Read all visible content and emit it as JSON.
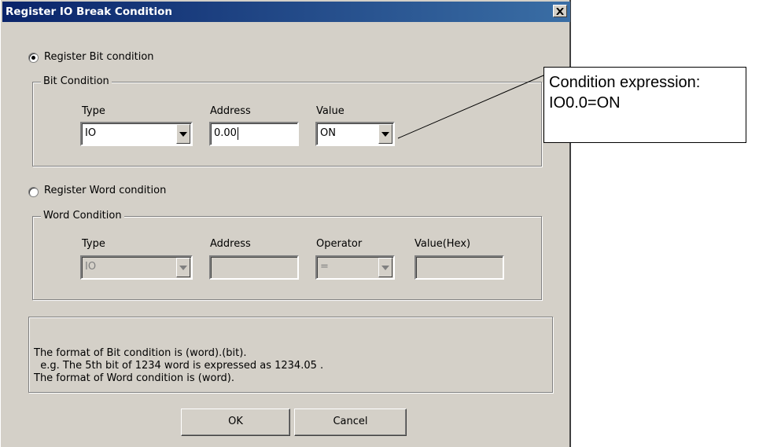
{
  "dialog": {
    "title": "Register IO Break Condition",
    "close_icon": "close-icon",
    "bit_radio": {
      "label": "Register Bit condition",
      "selected": true
    },
    "bit_group": {
      "legend": "Bit Condition",
      "type_label": "Type",
      "address_label": "Address",
      "value_label": "Value",
      "type_value": "IO",
      "address_value": "0.00",
      "value_value": "ON"
    },
    "word_radio": {
      "label": "Register Word condition",
      "selected": false
    },
    "word_group": {
      "legend": "Word Condition",
      "type_label": "Type",
      "address_label": "Address",
      "operator_label": "Operator",
      "value_label": "Value(Hex)",
      "type_value": "IO",
      "address_value": "",
      "operator_value": "=",
      "value_value": ""
    },
    "info": [
      "The format of Bit condition is (word).(bit).",
      "  e.g. The 5th bit of 1234 word is expressed as 1234.05 .",
      "The format of Word condition is (word)."
    ],
    "ok_label": "OK",
    "cancel_label": "Cancel"
  },
  "callout": {
    "line1": "Condition expression:",
    "line2": "IO0.0=ON"
  }
}
